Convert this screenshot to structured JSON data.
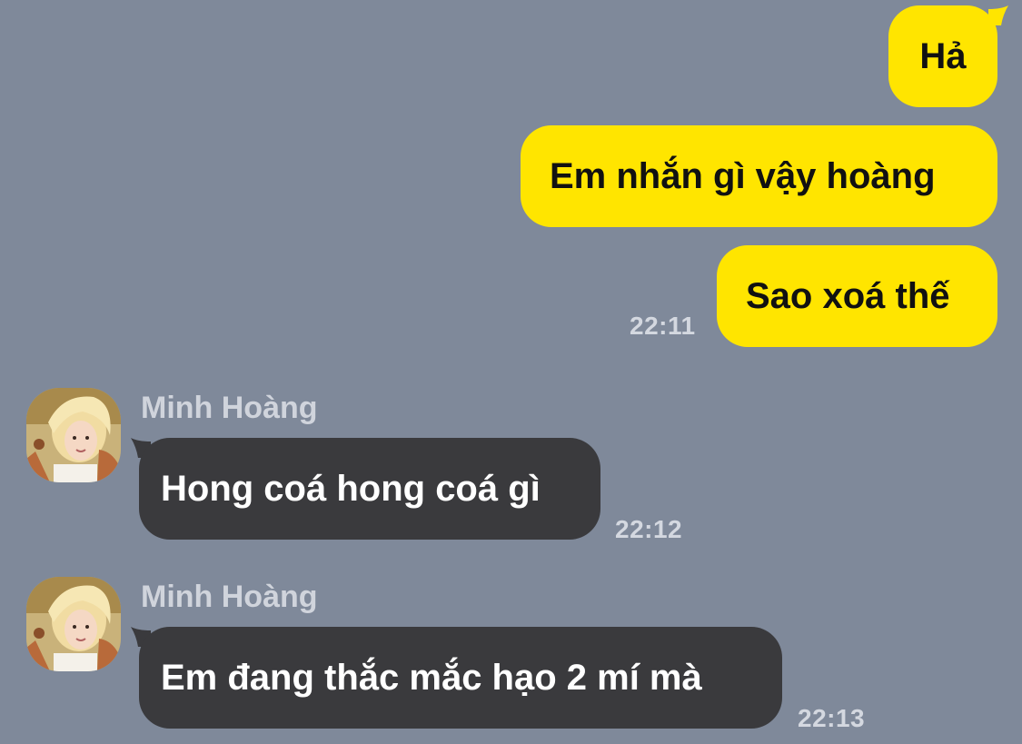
{
  "colors": {
    "background": "#7f899a",
    "outgoing_bubble": "#ffe500",
    "incoming_bubble": "#3a3a3d",
    "timestamp": "#d4d8e0"
  },
  "messages": [
    {
      "direction": "outgoing",
      "text": "Hả"
    },
    {
      "direction": "outgoing",
      "text": "Em nhắn gì vậy hoàng"
    },
    {
      "direction": "outgoing",
      "text": "Sao xoá thế",
      "time": "22:11"
    },
    {
      "direction": "incoming",
      "sender": "Minh Hoàng",
      "avatar_icon": "profile-avatar",
      "text": "Hong coá hong coá gì",
      "time": "22:12"
    },
    {
      "direction": "incoming",
      "sender": "Minh Hoàng",
      "avatar_icon": "profile-avatar",
      "text": "Em đang thắc mắc hạo 2 mí mà",
      "time": "22:13"
    }
  ]
}
